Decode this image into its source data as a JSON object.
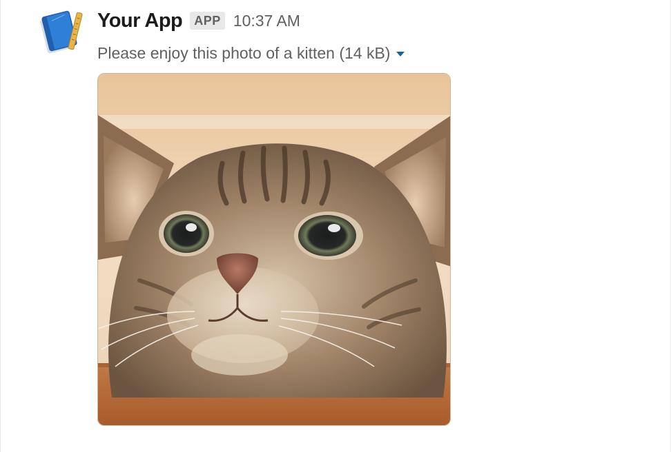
{
  "message": {
    "sender": "Your App",
    "badge": "APP",
    "timestamp": "10:37 AM",
    "file_description": "Please enjoy this photo of a kitten (14 kB)",
    "avatar_icon": "blueprint-book-icon",
    "attachment_icon": "chevron-down-icon",
    "image_subject": "kitten-photo"
  },
  "colors": {
    "sender_text": "#1d1c1d",
    "meta_text": "#616061",
    "badge_bg": "#e8e8e8",
    "caret": "#1264a3"
  }
}
